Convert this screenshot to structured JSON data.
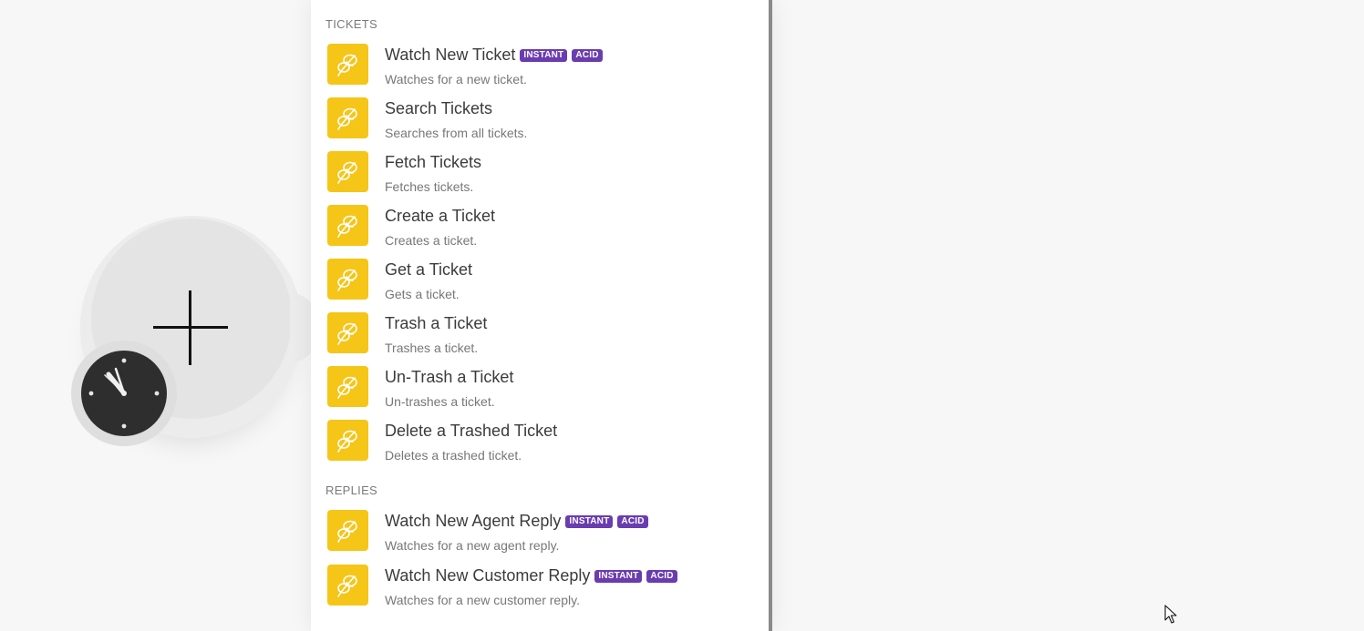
{
  "colors": {
    "app_icon_bg": "#f5c518",
    "badge_bg": "#6a3cb0",
    "panel_bg": "#ffffff",
    "canvas_bg": "#f7f7f7"
  },
  "module": {
    "add_icon": "plus-icon",
    "scheduler_icon": "clock-icon"
  },
  "sections": [
    {
      "title": "TICKETS",
      "items": [
        {
          "title": "Watch New Ticket",
          "desc": "Watches for a new ticket.",
          "badges": [
            "INSTANT",
            "ACID"
          ]
        },
        {
          "title": "Search Tickets",
          "desc": "Searches from all tickets.",
          "badges": []
        },
        {
          "title": "Fetch Tickets",
          "desc": "Fetches tickets.",
          "badges": []
        },
        {
          "title": "Create a Ticket",
          "desc": "Creates a ticket.",
          "badges": []
        },
        {
          "title": "Get a Ticket",
          "desc": "Gets a ticket.",
          "badges": []
        },
        {
          "title": "Trash a Ticket",
          "desc": "Trashes a ticket.",
          "badges": []
        },
        {
          "title": "Un-Trash a Ticket",
          "desc": "Un-trashes a ticket.",
          "badges": []
        },
        {
          "title": "Delete a Trashed Ticket",
          "desc": "Deletes a trashed ticket.",
          "badges": []
        }
      ]
    },
    {
      "title": "REPLIES",
      "items": [
        {
          "title": "Watch New Agent Reply",
          "desc": "Watches for a new agent reply.",
          "badges": [
            "INSTANT",
            "ACID"
          ]
        },
        {
          "title": "Watch New Customer Reply",
          "desc": "Watches for a new customer reply.",
          "badges": [
            "INSTANT",
            "ACID"
          ]
        }
      ]
    }
  ]
}
